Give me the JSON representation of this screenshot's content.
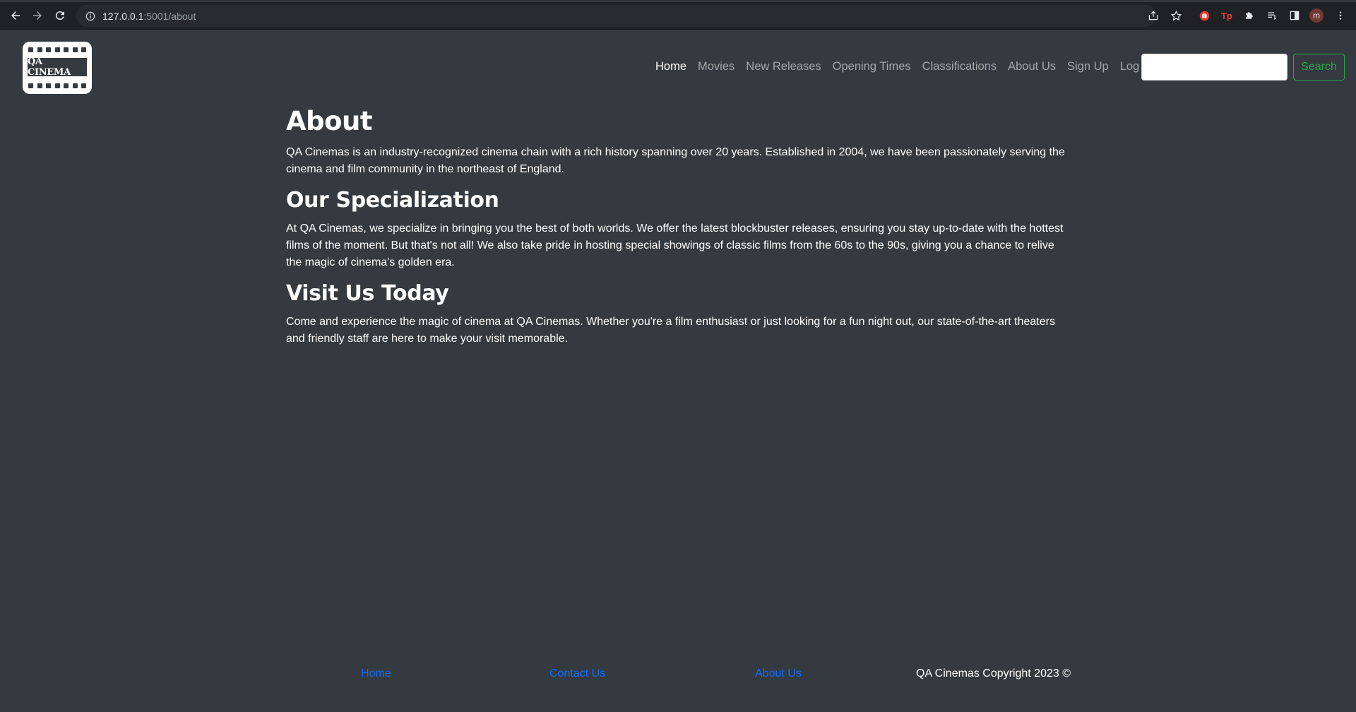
{
  "browser": {
    "url_host": "127.0.0.1",
    "url_rest": ":5001/about",
    "profile_initial": "m",
    "ext_tp_label": "Tp"
  },
  "navbar": {
    "logo_text": "QA CINEMA",
    "links": [
      {
        "label": "Home",
        "active": true
      },
      {
        "label": "Movies"
      },
      {
        "label": "New Releases"
      },
      {
        "label": "Opening Times"
      },
      {
        "label": "Classifications"
      },
      {
        "label": "About Us"
      },
      {
        "label": "Sign Up"
      },
      {
        "label": "Log In"
      }
    ],
    "search_value": "",
    "search_button": "Search"
  },
  "content": {
    "title": "About",
    "intro": "QA Cinemas is an industry-recognized cinema chain with a rich history spanning over 20 years. Established in 2004, we have been passionately serving the cinema and film community in the northeast of England.",
    "section1_heading": "Our Specialization",
    "section1_text": "At QA Cinemas, we specialize in bringing you the best of both worlds. We offer the latest blockbuster releases, ensuring you stay up-to-date with the hottest films of the moment. But that's not all! We also take pride in hosting special showings of classic films from the 60s to the 90s, giving you a chance to relive the magic of cinema's golden era.",
    "section2_heading": "Visit Us Today",
    "section2_text": "Come and experience the magic of cinema at QA Cinemas. Whether you're a film enthusiast or just looking for a fun night out, our state-of-the-art theaters and friendly staff are here to make your visit memorable."
  },
  "footer": {
    "home": "Home",
    "contact": "Contact Us",
    "about": "About Us",
    "copyright": "QA Cinemas Copyright 2023 ©"
  },
  "colors": {
    "page_bg": "#343a40",
    "link_blue": "#0d6efd",
    "search_green": "#28a745"
  }
}
